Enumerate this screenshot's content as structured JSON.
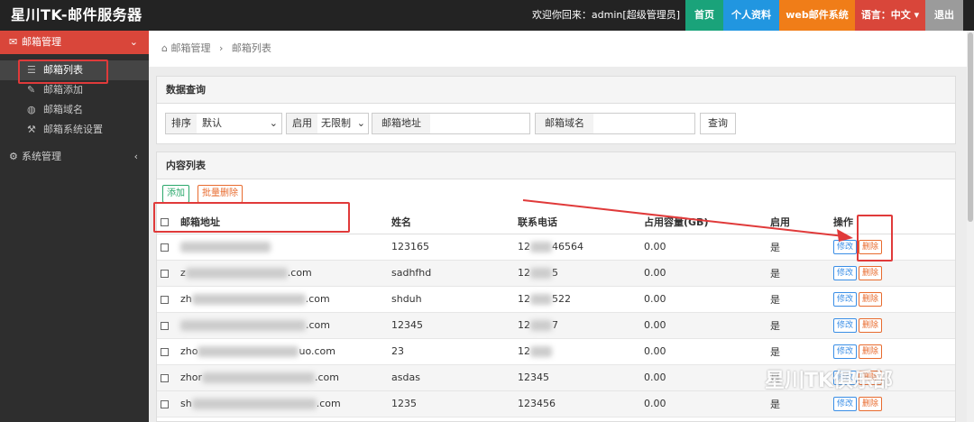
{
  "header": {
    "brand": "星川TK-邮件服务器",
    "welcome": "欢迎你回来：admin[超级管理员]",
    "nav": [
      {
        "label": "首页",
        "color": "#1aa37a"
      },
      {
        "label": "个人资料",
        "color": "#2196e0"
      },
      {
        "label": "web邮件系统",
        "color": "#f07d18"
      },
      {
        "label": "语言：中文",
        "color": "#d9463a"
      },
      {
        "label": "退出",
        "color": "#9b9b9b"
      }
    ]
  },
  "sidebar": {
    "group1": "邮箱管理",
    "items": [
      "邮箱列表",
      "邮箱添加",
      "邮箱域名",
      "邮箱系统设置"
    ],
    "group2": "系统管理"
  },
  "breadcrumb": {
    "home": "邮箱管理",
    "current": "邮箱列表"
  },
  "query": {
    "title": "数据查询",
    "sort_label": "排序",
    "sort_value": "默认",
    "enable_label": "启用",
    "enable_value": "无限制",
    "addr_label": "邮箱地址",
    "domain_label": "邮箱域名",
    "search_btn": "查询"
  },
  "list": {
    "title": "内容列表",
    "add_btn": "添加",
    "bulk_delete_btn": "批量删除",
    "columns": [
      "邮箱地址",
      "姓名",
      "联系电话",
      "占用容量(GB)",
      "启用",
      "操作"
    ],
    "edit": "修改",
    "delete": "删除",
    "rows": [
      {
        "email": "",
        "name": "123165",
        "phone": "12",
        "phone_tail": "46564",
        "size": "0.00",
        "enabled": "是"
      },
      {
        "email": "z",
        "email_tail": ".com",
        "name": "sadhfhd",
        "phone": "12",
        "phone_tail": "5",
        "size": "0.00",
        "enabled": "是"
      },
      {
        "email": "zh",
        "email_tail": ".com",
        "name": "shduh",
        "phone": "12",
        "phone_tail": "522",
        "size": "0.00",
        "enabled": "是"
      },
      {
        "email": "",
        "email_tail": ".com",
        "name": "12345",
        "phone": "12",
        "phone_tail": "7",
        "size": "0.00",
        "enabled": "是"
      },
      {
        "email": "zho",
        "email_tail": "uo.com",
        "name": "23",
        "phone": "12",
        "phone_tail": "",
        "size": "0.00",
        "enabled": "是"
      },
      {
        "email": "zhor",
        "email_tail": ".com",
        "name": "asdas",
        "phone": "12345",
        "phone_tail": "",
        "size": "0.00",
        "enabled": "是"
      },
      {
        "email": "sh",
        "email_tail": ".com",
        "name": "1235",
        "phone": "123456",
        "phone_tail": "",
        "size": "0.00",
        "enabled": "是"
      }
    ]
  },
  "watermark": "星川TK俱乐部"
}
